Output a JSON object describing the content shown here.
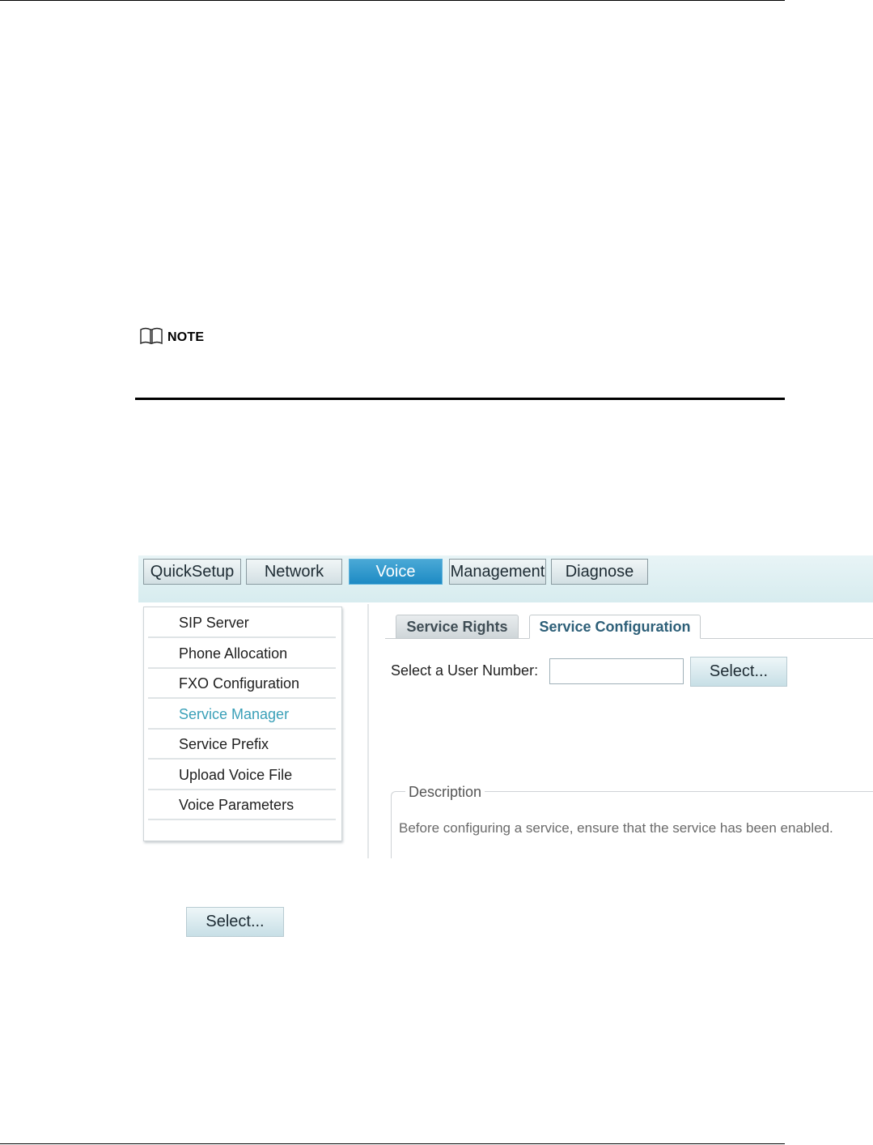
{
  "note": {
    "label": "NOTE",
    "icon": "book-icon"
  },
  "ui": {
    "nav_tabs": [
      {
        "label": "QuickSetup",
        "active": false
      },
      {
        "label": "Network",
        "active": false
      },
      {
        "label": "Voice",
        "active": true
      },
      {
        "label": "Management",
        "active": false
      },
      {
        "label": "Diagnose",
        "active": false
      }
    ],
    "menu": [
      {
        "label": "SIP Server",
        "active": false
      },
      {
        "label": "Phone Allocation",
        "active": false
      },
      {
        "label": "FXO Configuration",
        "active": false
      },
      {
        "label": "Service Manager",
        "active": true
      },
      {
        "label": "Service Prefix",
        "active": false
      },
      {
        "label": "Upload Voice File",
        "active": false
      },
      {
        "label": "Voice Parameters",
        "active": false
      }
    ],
    "subtabs": {
      "service_rights": "Service Rights",
      "service_configuration": "Service Configuration"
    },
    "user_number": {
      "label": "Select a User Number:",
      "value": "",
      "button_label": "Select..."
    },
    "description": {
      "legend": "Description",
      "text": "Before configuring a service, ensure that the service has been enabled."
    },
    "colors": {
      "active_tab": "#1d8ac4",
      "active_menu": "#3aa0b8",
      "topbar": "#d7ecef"
    }
  },
  "standalone_button": {
    "label": "Select..."
  }
}
